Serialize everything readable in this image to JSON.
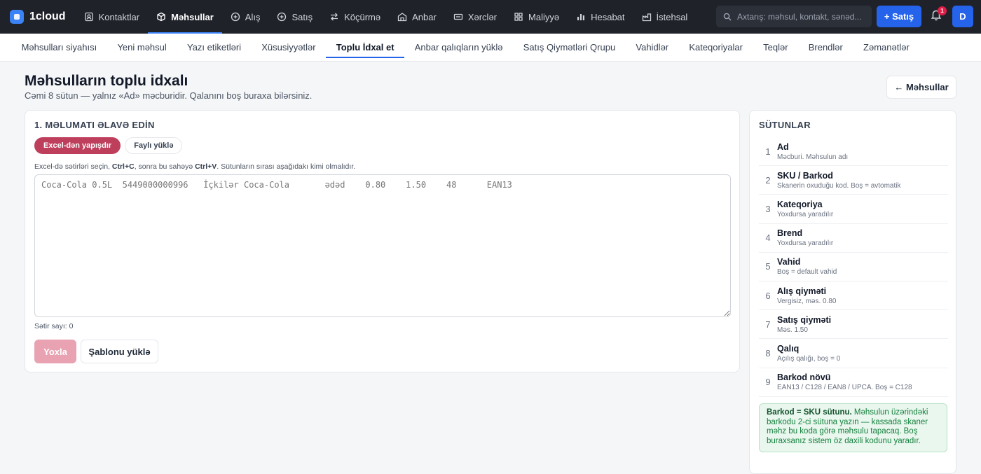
{
  "topbar": {
    "brand": "1cloud",
    "nav": [
      {
        "label": "Kontaktlar",
        "icon": "contacts-icon"
      },
      {
        "label": "Məhsullar",
        "icon": "box-icon",
        "active": true
      },
      {
        "label": "Alış",
        "icon": "plus-circle-icon"
      },
      {
        "label": "Satış",
        "icon": "plus-circle-icon"
      },
      {
        "label": "Köçürmə",
        "icon": "transfer-icon"
      },
      {
        "label": "Anbar",
        "icon": "warehouse-icon"
      },
      {
        "label": "Xərclər",
        "icon": "expense-icon"
      },
      {
        "label": "Maliyyə",
        "icon": "grid-icon"
      },
      {
        "label": "Hesabat",
        "icon": "bar-chart-icon"
      },
      {
        "label": "İstehsal",
        "icon": "factory-icon"
      }
    ],
    "search_placeholder": "Axtarış: məhsul, kontakt, sənəd...",
    "sale_button": "+ Satış",
    "notification_count": "1",
    "avatar_initial": "D"
  },
  "subnav": [
    {
      "label": "Məhsulları siyahısı"
    },
    {
      "label": "Yeni məhsul"
    },
    {
      "label": "Yazı etiketləri"
    },
    {
      "label": "Xüsusiyyətlər"
    },
    {
      "label": "Toplu İdxal et",
      "active": true
    },
    {
      "label": "Anbar qalıqların yüklə"
    },
    {
      "label": "Satış Qiymətləri Qrupu"
    },
    {
      "label": "Vahidlər"
    },
    {
      "label": "Kateqoriyalar"
    },
    {
      "label": "Teqlər"
    },
    {
      "label": "Brendlər"
    },
    {
      "label": "Zəmanətlər"
    }
  ],
  "page": {
    "title": "Məhsulların toplu idxalı",
    "subtitle": "Cəmi 8 sütun — yalnız «Ad» məcburidir. Qalanını boş buraxa bilərsiniz.",
    "back_button": "← Məhsullar"
  },
  "main": {
    "section_title": "1. MƏLUMATI ƏLAVƏ EDİN",
    "tabs": [
      {
        "label": "Excel-dən yapışdır",
        "active": true
      },
      {
        "label": "Faylı yüklə"
      }
    ],
    "hint_pre": "Excel-də sətirləri seçin, ",
    "hint_key1": "Ctrl+C",
    "hint_mid": ", sonra bu sahəyə ",
    "hint_key2": "Ctrl+V",
    "hint_post": ". Sütunların sırası aşağıdakı kimi olmalıdır.",
    "textarea_placeholder": "Coca-Cola 0.5L  5449000000996   İçkilər Coca-Cola       ədəd    0.80    1.50    48      EAN13",
    "row_count": "Sətir sayı: 0",
    "check_button": "Yoxla",
    "template_button": "Şablonu yüklə"
  },
  "side": {
    "title": "SÜTUNLAR",
    "columns": [
      {
        "num": "1",
        "name": "Ad",
        "desc": "Məcburi. Məhsulun adı"
      },
      {
        "num": "2",
        "name": "SKU / Barkod",
        "desc": "Skanerin oxuduğu kod. Boş = avtomatik"
      },
      {
        "num": "3",
        "name": "Kateqoriya",
        "desc": "Yoxdursa yaradılır"
      },
      {
        "num": "4",
        "name": "Brend",
        "desc": "Yoxdursa yaradılır"
      },
      {
        "num": "5",
        "name": "Vahid",
        "desc": "Boş = default vahid"
      },
      {
        "num": "6",
        "name": "Alış qiyməti",
        "desc": "Vergisiz, məs. 0.80"
      },
      {
        "num": "7",
        "name": "Satış qiyməti",
        "desc": "Məs. 1.50"
      },
      {
        "num": "8",
        "name": "Qalıq",
        "desc": "Açılış qalığı, boş = 0"
      },
      {
        "num": "9",
        "name": "Barkod növü",
        "desc": "EAN13 / C128 / EAN8 / UPCA. Boş = C128"
      }
    ],
    "note_bold": "Barkod = SKU sütunu.",
    "note_text": " Məhsulun üzərindəki barkodu 2-ci sütuna yazın — kassada skaner məhz bu koda görə məhsulu tapacaq. Boş buraxsanız sistem öz daxili kodunu yaradır."
  }
}
